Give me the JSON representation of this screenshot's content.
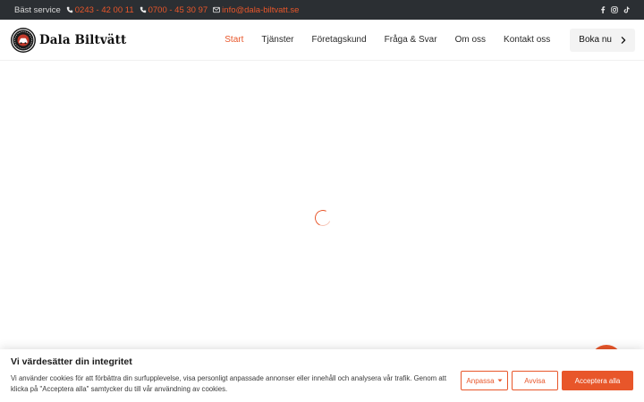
{
  "topbar": {
    "service_label": "Bäst service",
    "phone_1": "0243 - 42 00 11",
    "phone_2": "0700 - 45 30 97",
    "email": "info@dala-biltvatt.se",
    "social_icons": [
      "facebook-icon",
      "instagram-icon",
      "tiktok-icon"
    ]
  },
  "header": {
    "logo_text": "Dala Biltvätt",
    "nav": [
      {
        "label": "Start",
        "active": true
      },
      {
        "label": "Tjänster",
        "active": false
      },
      {
        "label": "Företagskund",
        "active": false
      },
      {
        "label": "Fråga & Svar",
        "active": false
      },
      {
        "label": "Om oss",
        "active": false
      },
      {
        "label": "Kontakt oss",
        "active": false
      }
    ],
    "book_button": "Boka nu"
  },
  "cookie_banner": {
    "title": "Vi värdesätter din integritet",
    "text": "Vi använder cookies för att förbättra din surfupplevelse, visa personligt anpassade annonser eller innehåll och analysera vår trafik. Genom att klicka på \"Acceptera alla\" samtycker du till vår användning av cookies.",
    "customize_label": "Anpassa",
    "reject_label": "Avvisa",
    "accept_label": "Acceptera alla"
  },
  "colors": {
    "accent": "#e8562a",
    "topbar_bg": "#2b2f33"
  }
}
